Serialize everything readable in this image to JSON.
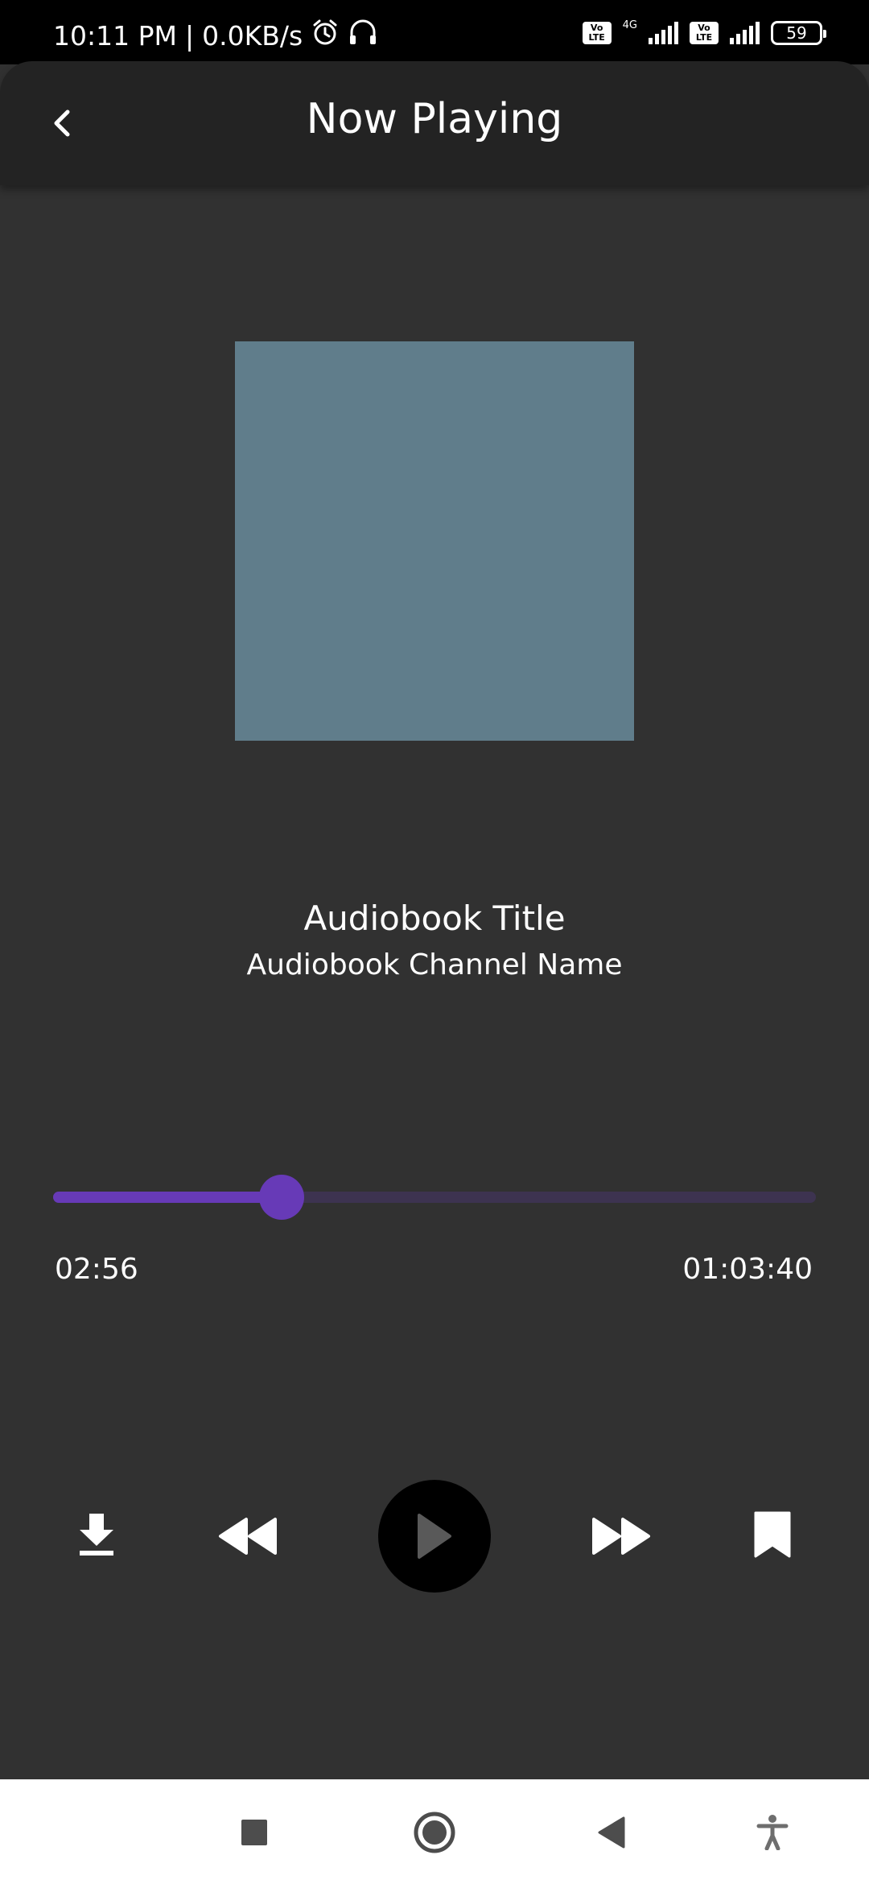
{
  "status_bar": {
    "time": "10:11 PM",
    "separator": "|",
    "net_speed": "0.0KB/s",
    "sim1_label_top": "Vo",
    "sim1_label_bottom": "LTE",
    "sim1_network": "4G",
    "sim2_label_top": "Vo",
    "sim2_label_bottom": "LTE",
    "battery": "59"
  },
  "app_bar": {
    "title": "Now Playing",
    "back_icon": "chevron-left-icon"
  },
  "cover": {
    "color": "#607d8b"
  },
  "book": {
    "title": "Audiobook Title",
    "channel": "Audiobook Channel Name"
  },
  "playback": {
    "elapsed": "02:56",
    "total": "01:03:40",
    "progress_fraction": 0.3,
    "accent_color": "#673ab7"
  },
  "controls": {
    "download_icon": "download-icon",
    "rewind_icon": "fast-rewind-icon",
    "play_icon": "play-icon",
    "forward_icon": "fast-forward-icon",
    "bookmark_icon": "bookmark-icon"
  },
  "nav_bar": {
    "recents_icon": "recents-square-icon",
    "home_icon": "home-circle-icon",
    "back_icon": "back-triangle-icon",
    "accessibility_icon": "accessibility-icon"
  }
}
